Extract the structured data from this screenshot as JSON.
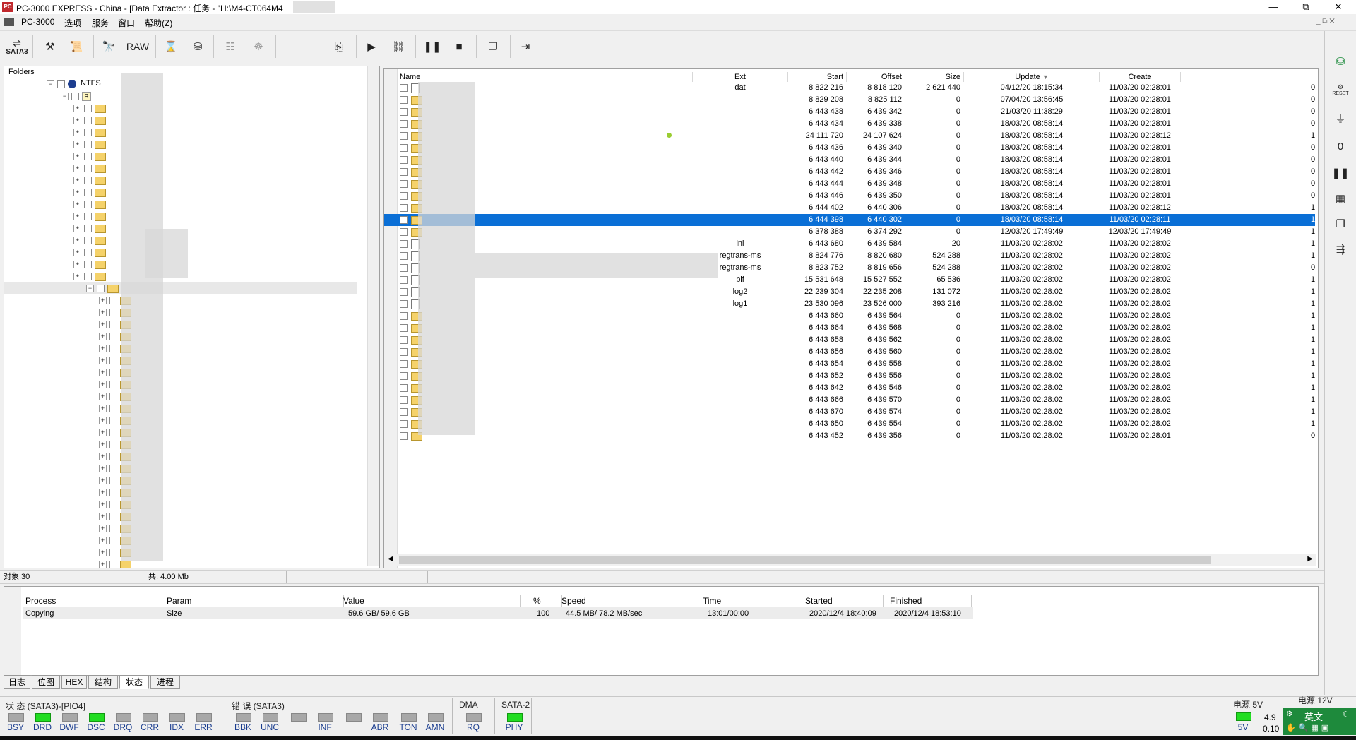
{
  "title": "PC-3000 EXPRESS - China - [Data Extractor : 任务 - \"H:\\M4-CT064M4",
  "window_controls": {
    "minimize": "—",
    "maximize": "⧉",
    "close": "✕"
  },
  "menu": [
    "PC-3000",
    "选项",
    "服务",
    "窗口",
    "帮助(Z)"
  ],
  "toolbar": {
    "sata_label": "SATA3",
    "raw_label": "RAW"
  },
  "folders": {
    "header": "Folders",
    "root_label": "NTFS",
    "root_icon": "R"
  },
  "files": {
    "columns": [
      "Name",
      "Ext",
      "Start",
      "Offset",
      "Size",
      "Update",
      "Create"
    ],
    "sort_indicator": "▼",
    "rows": [
      {
        "ext": "dat",
        "start": "8 822 216",
        "offset": "8 818 120",
        "size": "2 621 440",
        "update": "04/12/20 18:15:34",
        "create": "11/03/20 02:28:01",
        "tail": "0",
        "type": "file"
      },
      {
        "ext": "",
        "start": "8 829 208",
        "offset": "8 825 112",
        "size": "0",
        "update": "07/04/20 13:56:45",
        "create": "11/03/20 02:28:01",
        "tail": "0",
        "type": "folder"
      },
      {
        "ext": "",
        "start": "6 443 438",
        "offset": "6 439 342",
        "size": "0",
        "update": "21/03/20 11:38:29",
        "create": "11/03/20 02:28:01",
        "tail": "0",
        "type": "folder"
      },
      {
        "ext": "",
        "start": "6 443 434",
        "offset": "6 439 338",
        "size": "0",
        "update": "18/03/20 08:58:14",
        "create": "11/03/20 02:28:01",
        "tail": "0",
        "type": "folder"
      },
      {
        "ext": "",
        "start": "24 111 720",
        "offset": "24 107 624",
        "size": "0",
        "update": "18/03/20 08:58:14",
        "create": "11/03/20 02:28:12",
        "tail": "1",
        "type": "folder"
      },
      {
        "ext": "",
        "start": "6 443 436",
        "offset": "6 439 340",
        "size": "0",
        "update": "18/03/20 08:58:14",
        "create": "11/03/20 02:28:01",
        "tail": "0",
        "type": "folder"
      },
      {
        "ext": "",
        "start": "6 443 440",
        "offset": "6 439 344",
        "size": "0",
        "update": "18/03/20 08:58:14",
        "create": "11/03/20 02:28:01",
        "tail": "0",
        "type": "folder"
      },
      {
        "ext": "",
        "start": "6 443 442",
        "offset": "6 439 346",
        "size": "0",
        "update": "18/03/20 08:58:14",
        "create": "11/03/20 02:28:01",
        "tail": "0",
        "type": "folder"
      },
      {
        "ext": "",
        "start": "6 443 444",
        "offset": "6 439 348",
        "size": "0",
        "update": "18/03/20 08:58:14",
        "create": "11/03/20 02:28:01",
        "tail": "0",
        "type": "folder"
      },
      {
        "ext": "",
        "start": "6 443 446",
        "offset": "6 439 350",
        "size": "0",
        "update": "18/03/20 08:58:14",
        "create": "11/03/20 02:28:01",
        "tail": "0",
        "type": "folder"
      },
      {
        "ext": "",
        "start": "6 444 402",
        "offset": "6 440 306",
        "size": "0",
        "update": "18/03/20 08:58:14",
        "create": "11/03/20 02:28:12",
        "tail": "1",
        "type": "folder"
      },
      {
        "ext": "",
        "start": "6 444 398",
        "offset": "6 440 302",
        "size": "0",
        "update": "18/03/20 08:58:14",
        "create": "11/03/20 02:28:11",
        "tail": "1",
        "type": "folder",
        "selected": true
      },
      {
        "ext": "",
        "start": "6 378 388",
        "offset": "6 374 292",
        "size": "0",
        "update": "12/03/20 17:49:49",
        "create": "12/03/20 17:49:49",
        "tail": "1",
        "type": "folder"
      },
      {
        "ext": "ini",
        "start": "6 443 680",
        "offset": "6 439 584",
        "size": "20",
        "update": "11/03/20 02:28:02",
        "create": "11/03/20 02:28:02",
        "tail": "1",
        "type": "file"
      },
      {
        "ext": "regtrans-ms",
        "start": "8 824 776",
        "offset": "8 820 680",
        "size": "524 288",
        "update": "11/03/20 02:28:02",
        "create": "11/03/20 02:28:02",
        "tail": "1",
        "type": "file"
      },
      {
        "ext": "regtrans-ms",
        "start": "8 823 752",
        "offset": "8 819 656",
        "size": "524 288",
        "update": "11/03/20 02:28:02",
        "create": "11/03/20 02:28:02",
        "tail": "0",
        "type": "file"
      },
      {
        "ext": "blf",
        "start": "15 531 648",
        "offset": "15 527 552",
        "size": "65 536",
        "update": "11/03/20 02:28:02",
        "create": "11/03/20 02:28:02",
        "tail": "1",
        "type": "file"
      },
      {
        "ext": "log2",
        "start": "22 239 304",
        "offset": "22 235 208",
        "size": "131 072",
        "update": "11/03/20 02:28:02",
        "create": "11/03/20 02:28:02",
        "tail": "1",
        "type": "file"
      },
      {
        "ext": "log1",
        "start": "23 530 096",
        "offset": "23 526 000",
        "size": "393 216",
        "update": "11/03/20 02:28:02",
        "create": "11/03/20 02:28:02",
        "tail": "1",
        "type": "file"
      },
      {
        "ext": "",
        "start": "6 443 660",
        "offset": "6 439 564",
        "size": "0",
        "update": "11/03/20 02:28:02",
        "create": "11/03/20 02:28:02",
        "tail": "1",
        "type": "folder"
      },
      {
        "ext": "",
        "start": "6 443 664",
        "offset": "6 439 568",
        "size": "0",
        "update": "11/03/20 02:28:02",
        "create": "11/03/20 02:28:02",
        "tail": "1",
        "type": "folder"
      },
      {
        "ext": "",
        "start": "6 443 658",
        "offset": "6 439 562",
        "size": "0",
        "update": "11/03/20 02:28:02",
        "create": "11/03/20 02:28:02",
        "tail": "1",
        "type": "folder"
      },
      {
        "ext": "",
        "start": "6 443 656",
        "offset": "6 439 560",
        "size": "0",
        "update": "11/03/20 02:28:02",
        "create": "11/03/20 02:28:02",
        "tail": "1",
        "type": "folder"
      },
      {
        "ext": "",
        "start": "6 443 654",
        "offset": "6 439 558",
        "size": "0",
        "update": "11/03/20 02:28:02",
        "create": "11/03/20 02:28:02",
        "tail": "1",
        "type": "folder"
      },
      {
        "ext": "",
        "start": "6 443 652",
        "offset": "6 439 556",
        "size": "0",
        "update": "11/03/20 02:28:02",
        "create": "11/03/20 02:28:02",
        "tail": "1",
        "type": "folder"
      },
      {
        "ext": "",
        "start": "6 443 642",
        "offset": "6 439 546",
        "size": "0",
        "update": "11/03/20 02:28:02",
        "create": "11/03/20 02:28:02",
        "tail": "1",
        "type": "folder"
      },
      {
        "ext": "",
        "start": "6 443 666",
        "offset": "6 439 570",
        "size": "0",
        "update": "11/03/20 02:28:02",
        "create": "11/03/20 02:28:02",
        "tail": "1",
        "type": "folder"
      },
      {
        "ext": "",
        "start": "6 443 670",
        "offset": "6 439 574",
        "size": "0",
        "update": "11/03/20 02:28:02",
        "create": "11/03/20 02:28:02",
        "tail": "1",
        "type": "folder"
      },
      {
        "ext": "",
        "start": "6 443 650",
        "offset": "6 439 554",
        "size": "0",
        "update": "11/03/20 02:28:02",
        "create": "11/03/20 02:28:02",
        "tail": "1",
        "type": "folder"
      },
      {
        "ext": "",
        "start": "6 443 452",
        "offset": "6 439 356",
        "size": "0",
        "update": "11/03/20 02:28:02",
        "create": "11/03/20 02:28:01",
        "tail": "0",
        "type": "folder"
      }
    ]
  },
  "status_bar": {
    "objects": "对象:30",
    "size": "共: 4.00 Mb"
  },
  "process": {
    "columns": [
      "Process",
      "Param",
      "Value",
      "%",
      "Speed",
      "Time",
      "Started",
      "Finished"
    ],
    "row": [
      "Copying",
      "Size",
      "59.6 GB/ 59.6 GB",
      "100",
      "44.5 MB/ 78.2 MB/sec",
      "13:01/00:00",
      "2020/12/4 18:40:09",
      "2020/12/4 18:53:10"
    ]
  },
  "tabs": [
    "日志",
    "位图",
    "HEX",
    "结构",
    "状态",
    "进程"
  ],
  "active_tab": "状态",
  "leds": {
    "status_group": "状 态 (SATA3)-[PIO4]",
    "status": [
      {
        "label": "BSY",
        "on": false
      },
      {
        "label": "DRD",
        "on": true
      },
      {
        "label": "DWF",
        "on": false
      },
      {
        "label": "DSC",
        "on": true
      },
      {
        "label": "DRQ",
        "on": false
      },
      {
        "label": "CRR",
        "on": false
      },
      {
        "label": "IDX",
        "on": false
      },
      {
        "label": "ERR",
        "on": false
      }
    ],
    "error_group": "错 误 (SATA3)",
    "errors": [
      "BBK",
      "UNC",
      "",
      "INF",
      "",
      "ABR",
      "TON",
      "AMN"
    ],
    "dma_group": "DMA",
    "dma": "RQ",
    "sata_group": "SATA-2",
    "sata": "PHY",
    "power5_label": "电源 5V",
    "power5_led": "5V",
    "power5_v": "4.9",
    "power5_a": "0.10",
    "power12_label": "电源 12V"
  },
  "ime": {
    "lang": "英文"
  },
  "colors": {
    "selection": "#0a6fd6",
    "led_on": "#22dd22",
    "led_off": "#a8a8a8"
  }
}
